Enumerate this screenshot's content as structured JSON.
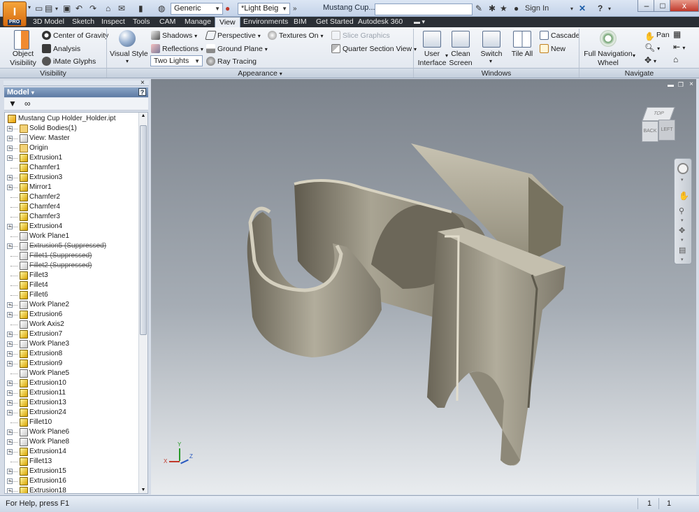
{
  "app": {
    "badge": "I",
    "edition": "PRO"
  },
  "quick_access": {
    "style_select": "Generic",
    "color_select": "*Light Beig",
    "more": "»"
  },
  "title_bar": {
    "document_title": "Mustang Cup...",
    "sign_in": "Sign In",
    "minimize": "–",
    "maximize": "□",
    "close": "x"
  },
  "tabs": [
    "3D Model",
    "Sketch",
    "Inspect",
    "Tools",
    "CAM",
    "Manage",
    "View",
    "Environments",
    "BIM",
    "Get Started",
    "Autodesk 360"
  ],
  "active_tab": "View",
  "ribbon": {
    "visibility": {
      "label": "Visibility",
      "object_visibility": "Object\nVisibility",
      "center_of_gravity": "Center of Gravity",
      "analysis": "Analysis",
      "imate_glyphs": "iMate Glyphs"
    },
    "appearance": {
      "label": "Appearance",
      "visual_style": "Visual Style",
      "shadows": "Shadows",
      "reflections": "Reflections",
      "lighting": "Two Lights",
      "perspective": "Perspective",
      "ground_plane": "Ground Plane",
      "ray_tracing": "Ray Tracing",
      "textures_on": "Textures On",
      "slice_graphics": "Slice Graphics",
      "quarter_section": "Quarter Section View"
    },
    "windows": {
      "label": "Windows",
      "user_interface": "User\nInterface",
      "clean_screen": "Clean\nScreen",
      "switch": "Switch",
      "tile_all": "Tile All",
      "cascade": "Cascade",
      "new": "New"
    },
    "navigate": {
      "label": "Navigate",
      "full_nav_wheel": "Full Navigation\nWheel",
      "pan": "Pan"
    }
  },
  "browser": {
    "title": "Model",
    "help": "?",
    "tree": [
      {
        "label": "Mustang Cup Holder_Holder.ipt",
        "icon": "part",
        "exp": false,
        "indent": 0
      },
      {
        "label": "Solid Bodies(1)",
        "icon": "folder",
        "exp": true
      },
      {
        "label": "View: Master",
        "icon": "view",
        "exp": true
      },
      {
        "label": "Origin",
        "icon": "folder",
        "exp": true
      },
      {
        "label": "Extrusion1",
        "icon": "feat",
        "exp": true
      },
      {
        "label": "Chamfer1",
        "icon": "feat",
        "exp": false
      },
      {
        "label": "Extrusion3",
        "icon": "feat",
        "exp": true
      },
      {
        "label": "Mirror1",
        "icon": "feat",
        "exp": true
      },
      {
        "label": "Chamfer2",
        "icon": "feat",
        "exp": false
      },
      {
        "label": "Chamfer4",
        "icon": "feat",
        "exp": false
      },
      {
        "label": "Chamfer3",
        "icon": "feat",
        "exp": false
      },
      {
        "label": "Extrusion4",
        "icon": "feat",
        "exp": true
      },
      {
        "label": "Work Plane1",
        "icon": "plane",
        "exp": false
      },
      {
        "label": "Extrusion5 (Suppressed)",
        "icon": "plane",
        "exp": true,
        "sup": true
      },
      {
        "label": "Fillet1 (Suppressed)",
        "icon": "plane",
        "exp": false,
        "sup": true
      },
      {
        "label": "Fillet2 (Suppressed)",
        "icon": "plane",
        "exp": false,
        "sup": true
      },
      {
        "label": "Fillet3",
        "icon": "feat",
        "exp": false
      },
      {
        "label": "Fillet4",
        "icon": "feat",
        "exp": false
      },
      {
        "label": "Fillet6",
        "icon": "feat",
        "exp": false
      },
      {
        "label": "Work Plane2",
        "icon": "plane",
        "exp": true
      },
      {
        "label": "Extrusion6",
        "icon": "feat",
        "exp": true
      },
      {
        "label": "Work Axis2",
        "icon": "plane",
        "exp": false
      },
      {
        "label": "Extrusion7",
        "icon": "feat",
        "exp": true
      },
      {
        "label": "Work Plane3",
        "icon": "plane",
        "exp": true
      },
      {
        "label": "Extrusion8",
        "icon": "feat",
        "exp": true
      },
      {
        "label": "Extrusion9",
        "icon": "feat",
        "exp": true
      },
      {
        "label": "Work Plane5",
        "icon": "plane",
        "exp": false
      },
      {
        "label": "Extrusion10",
        "icon": "feat",
        "exp": true
      },
      {
        "label": "Extrusion11",
        "icon": "feat",
        "exp": true
      },
      {
        "label": "Extrusion13",
        "icon": "feat",
        "exp": true
      },
      {
        "label": "Extrusion24",
        "icon": "feat",
        "exp": true
      },
      {
        "label": "Fillet10",
        "icon": "feat",
        "exp": false
      },
      {
        "label": "Work Plane6",
        "icon": "plane",
        "exp": true
      },
      {
        "label": "Work Plane8",
        "icon": "plane",
        "exp": true
      },
      {
        "label": "Extrusion14",
        "icon": "feat",
        "exp": true
      },
      {
        "label": "Fillet13",
        "icon": "feat",
        "exp": false
      },
      {
        "label": "Extrusion15",
        "icon": "feat",
        "exp": true
      },
      {
        "label": "Extrusion16",
        "icon": "feat",
        "exp": true
      },
      {
        "label": "Extrusion18",
        "icon": "feat",
        "exp": true
      }
    ]
  },
  "viewcube": {
    "top": "TOP",
    "back": "BACK",
    "left": "LEFT"
  },
  "axis": {
    "x": "X",
    "y": "Y",
    "z": "Z"
  },
  "status": {
    "help": "For Help, press F1",
    "count1": "1",
    "count2": "1"
  }
}
